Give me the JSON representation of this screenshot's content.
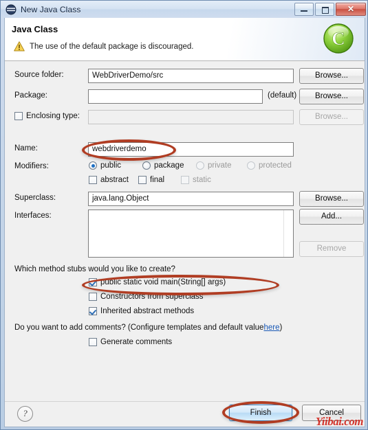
{
  "window": {
    "title": "New Java Class",
    "title_icon": "java-package-icon",
    "controls": {
      "minimize": "minimize-icon",
      "maximize": "maximize-icon",
      "close": "✕"
    }
  },
  "banner": {
    "title": "Java Class",
    "warning_icon": "warning-triangle-icon",
    "message": "The use of the default package is discouraged.",
    "page_icon": "java-class-green-c-icon"
  },
  "form": {
    "source_folder": {
      "label": "Source folder:",
      "value": "WebDriverDemo/src",
      "browse": "Browse..."
    },
    "package": {
      "label": "Package:",
      "value": "",
      "suffix": "(default)",
      "browse": "Browse..."
    },
    "enclosing_type": {
      "label": "Enclosing type:",
      "checked": false,
      "value": "",
      "browse": "Browse...",
      "disabled": true
    },
    "name": {
      "label": "Name:",
      "value": "webdriverdemo"
    },
    "modifiers": {
      "label": "Modifiers:",
      "radios": [
        {
          "label": "public",
          "checked": true,
          "disabled": false
        },
        {
          "label": "package",
          "checked": false,
          "disabled": false
        },
        {
          "label": "private",
          "checked": false,
          "disabled": true
        },
        {
          "label": "protected",
          "checked": false,
          "disabled": true
        }
      ],
      "checkboxes": [
        {
          "label": "abstract",
          "checked": false,
          "disabled": false
        },
        {
          "label": "final",
          "checked": false,
          "disabled": false
        },
        {
          "label": "static",
          "checked": false,
          "disabled": true
        }
      ]
    },
    "superclass": {
      "label": "Superclass:",
      "value": "java.lang.Object",
      "browse": "Browse..."
    },
    "interfaces": {
      "label": "Interfaces:",
      "items": [],
      "add": "Add...",
      "remove": "Remove"
    },
    "method_stubs": {
      "question": "Which method stubs would you like to create?",
      "options": [
        {
          "label": "public static void main(String[] args)",
          "checked": true
        },
        {
          "label": "Constructors from superclass",
          "checked": false
        },
        {
          "label": "Inherited abstract methods",
          "checked": true
        }
      ]
    },
    "comments": {
      "prefix": "Do you want to add comments? (Configure templates and default value ",
      "link": "here",
      "suffix": ")",
      "checkbox": {
        "label": "Generate comments",
        "checked": false
      }
    }
  },
  "buttonbar": {
    "help": "?",
    "finish": "Finish",
    "cancel": "Cancel"
  },
  "watermark": "Yiibai.com",
  "colors": {
    "annotation": "#b03d23",
    "link": "#1757b5",
    "accent": "#1d6fc4",
    "watermark": "#d2281e"
  }
}
